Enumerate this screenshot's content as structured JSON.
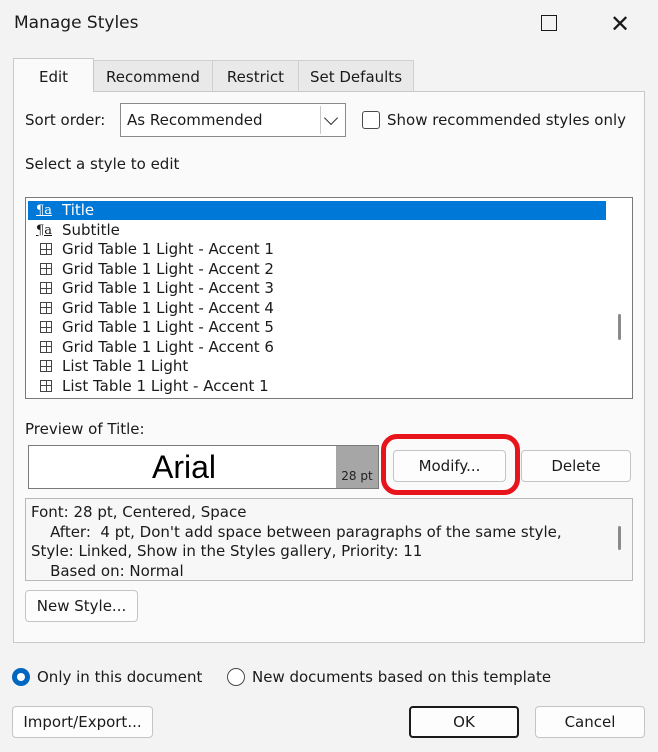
{
  "window": {
    "title": "Manage Styles",
    "close_glyph": "✕"
  },
  "tabs": [
    {
      "label": "Edit",
      "active": true
    },
    {
      "label": "Recommend",
      "active": false
    },
    {
      "label": "Restrict",
      "active": false
    },
    {
      "label": "Set Defaults",
      "active": false
    }
  ],
  "sort": {
    "label": "Sort order:",
    "value": "As Recommended"
  },
  "show_recommended": {
    "label": "Show recommended styles only",
    "checked": false
  },
  "select_label": "Select a style to edit",
  "styles": [
    {
      "name": "Title",
      "icon": "linked-style-icon",
      "selected": true
    },
    {
      "name": "Subtitle",
      "icon": "linked-style-icon",
      "selected": false
    },
    {
      "name": "Grid Table 1 Light - Accent 1",
      "icon": "table-style-icon",
      "selected": false
    },
    {
      "name": "Grid Table 1 Light - Accent 2",
      "icon": "table-style-icon",
      "selected": false
    },
    {
      "name": "Grid Table 1 Light - Accent 3",
      "icon": "table-style-icon",
      "selected": false
    },
    {
      "name": "Grid Table 1 Light - Accent 4",
      "icon": "table-style-icon",
      "selected": false
    },
    {
      "name": "Grid Table 1 Light - Accent 5",
      "icon": "table-style-icon",
      "selected": false
    },
    {
      "name": "Grid Table 1 Light - Accent 6",
      "icon": "table-style-icon",
      "selected": false
    },
    {
      "name": "List Table 1 Light",
      "icon": "table-style-icon",
      "selected": false
    },
    {
      "name": "List Table 1 Light - Accent 1",
      "icon": "table-style-icon",
      "selected": false
    }
  ],
  "preview": {
    "label": "Preview of Title:",
    "font": "Arial",
    "size": "28 pt"
  },
  "buttons": {
    "modify": "Modify...",
    "delete": "Delete",
    "new_style": "New Style...",
    "import_export": "Import/Export...",
    "ok": "OK",
    "cancel": "Cancel"
  },
  "description": [
    "Font: 28 pt, Centered, Space",
    "    After:  4 pt, Don't add space between paragraphs of the same style,",
    "Style: Linked, Show in the Styles gallery, Priority: 11",
    "    Based on: Normal"
  ],
  "scope": {
    "only_this": {
      "label": "Only in this document",
      "selected": true
    },
    "new_docs": {
      "label": "New documents based on this template",
      "selected": false
    }
  },
  "colors": {
    "accent": "#0067c0",
    "selection": "#0078d7",
    "annotation": "#e8141c"
  }
}
